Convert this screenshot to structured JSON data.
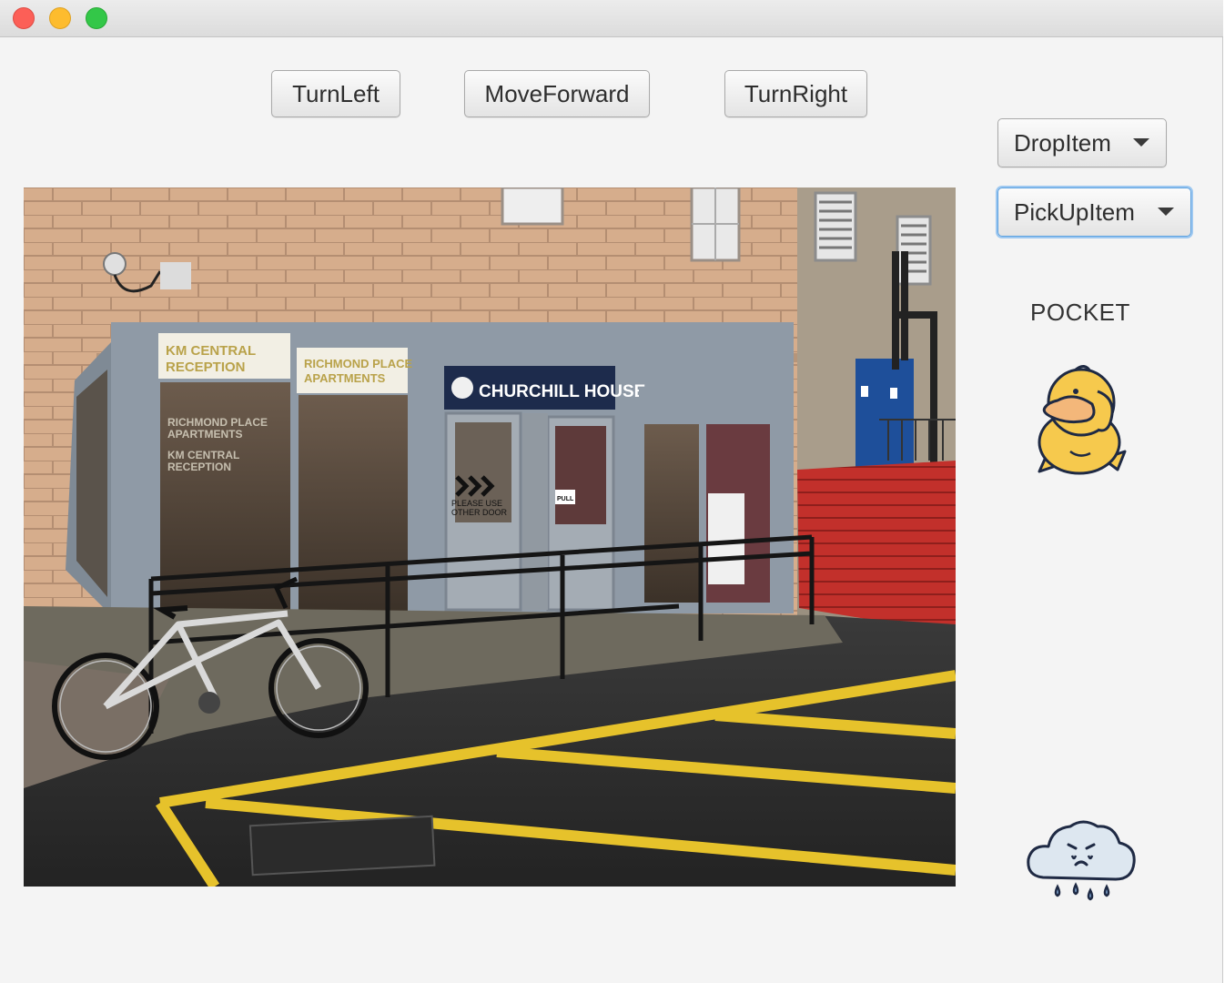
{
  "window": {
    "controls": {
      "close": "close-icon",
      "minimize": "minimize-icon",
      "maximize": "maximize-icon"
    }
  },
  "controls": {
    "turn_left": "TurnLeft",
    "move_forward": "MoveForward",
    "turn_right": "TurnRight",
    "drop_item": "DropItem",
    "pick_up_item": "PickUpItem"
  },
  "pocket": {
    "label": "POCKET",
    "item_icon": "duck-icon"
  },
  "status_icon": "crying-cloud-icon",
  "scene": {
    "signs": {
      "km_reception_1": "KM CENTRAL",
      "km_reception_2": "RECEPTION",
      "richmond_1": "RICHMOND PLACE",
      "richmond_2": "APARTMENTS",
      "richmond_glass_1": "RICHMOND PLACE",
      "richmond_glass_2": "APARTMENTS",
      "km_glass_1": "KM CENTRAL",
      "km_glass_2": "RECEPTION",
      "churchill": "CHURCHILL HOUSE",
      "door_note_1": "PLEASE USE",
      "door_note_2": "OTHER DOOR",
      "pull": "PULL"
    }
  },
  "colors": {
    "window_bg": "#f4f4f4",
    "focus_ring": "#9ec8f0",
    "sign_navy": "#1d2b4c",
    "red_wall": "#c2302b",
    "line_yellow": "#e6c22b"
  }
}
